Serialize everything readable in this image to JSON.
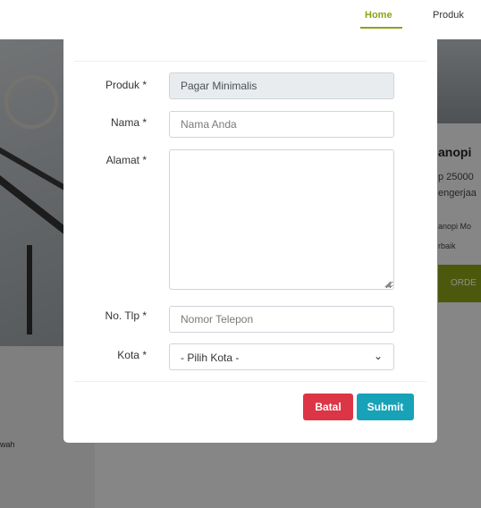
{
  "nav": {
    "home": "Home",
    "produk": "Produk"
  },
  "background": {
    "product_title": "anopi",
    "price_line": "p 25000",
    "work_line": "engerjaa",
    "desc_line1": "anopi Mo",
    "desc_line2": "rbaik",
    "order_button": "ORDE",
    "left_text": "wah"
  },
  "form": {
    "produk_label": "Produk *",
    "produk_value": "Pagar Minimalis",
    "nama_label": "Nama *",
    "nama_placeholder": "Nama Anda",
    "alamat_label": "Alamat *",
    "alamat_value": "",
    "notlp_label": "No. Tlp *",
    "notlp_placeholder": "Nomor Telepon",
    "kota_label": "Kota *",
    "kota_selected": "- Pilih Kota -"
  },
  "buttons": {
    "batal": "Batal",
    "submit": "Submit"
  },
  "colors": {
    "accent": "#8aa317",
    "danger": "#dc3545",
    "info": "#17a2b8"
  }
}
